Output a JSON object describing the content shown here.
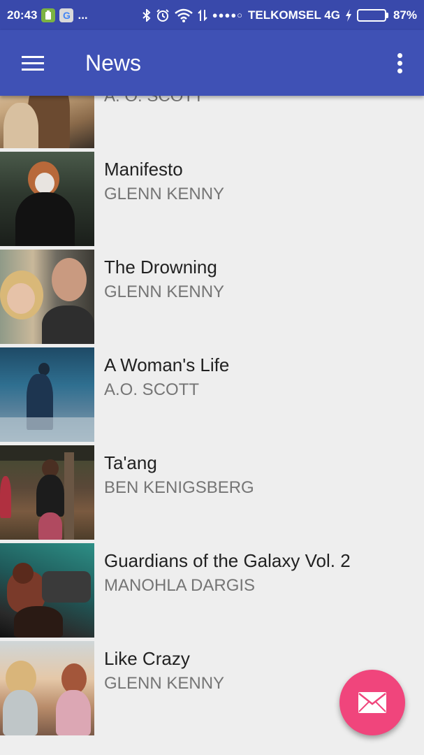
{
  "status_bar": {
    "time": "20:43",
    "more": "...",
    "signal_dots": "●●●●○",
    "carrier": "TELKOMSEL 4G",
    "battery_percent": "87%",
    "battery_level": 0.87
  },
  "app_bar": {
    "title": "News",
    "background": "#3f51b5"
  },
  "articles": [
    {
      "title": "",
      "author": "A. O. SCOTT"
    },
    {
      "title": "Manifesto",
      "author": "GLENN KENNY"
    },
    {
      "title": "The Drowning",
      "author": "GLENN KENNY"
    },
    {
      "title": "A Woman's Life",
      "author": "A.O. SCOTT"
    },
    {
      "title": "Ta'ang",
      "author": "BEN KENIGSBERG"
    },
    {
      "title": "Guardians of the Galaxy Vol. 2",
      "author": "MANOHLA DARGIS"
    },
    {
      "title": "Like Crazy",
      "author": "GLENN KENNY"
    }
  ],
  "fab": {
    "icon": "email-icon",
    "color": "#f0457c"
  }
}
